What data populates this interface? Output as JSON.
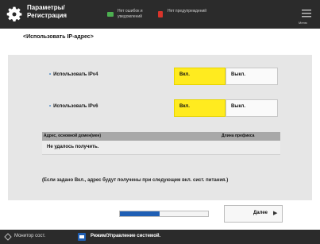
{
  "header": {
    "title_line1": "Параметры/",
    "title_line2": "Регистрация",
    "status_items": [
      {
        "icon": "toner-ok-icon",
        "text": "Нет ошибок и уведомлений"
      },
      {
        "icon": "warning-icon",
        "text": "Нет предупреждений"
      }
    ],
    "menu_label": "Меню",
    "colors": {
      "bar": "#2b2b2b"
    }
  },
  "breadcrumb": "<Использовать IP-адрес>",
  "settings": {
    "ipv4": {
      "label": "Использовать IPv4",
      "on_label": "Вкл.",
      "off_label": "Выкл.",
      "selected": "on"
    },
    "ipv6": {
      "label": "Использовать IPv6",
      "on_label": "Вкл.",
      "off_label": "Выкл.",
      "selected": "on"
    }
  },
  "table": {
    "headers": [
      "Адрес, основной домен(мен)",
      "Длина префикса"
    ],
    "rows": [
      [
        "Не удалось получить.",
        ""
      ]
    ]
  },
  "note": "(Если задано Вкл., адрес будут получены при следующем вкл. сист. питания.)",
  "footer": {
    "progress_fraction": 0.45,
    "next_label": "Далее",
    "next_arrow": "▶"
  },
  "bottom": {
    "monitor_label": "Монитор сост.",
    "system_label": "Режим/Управление системой.",
    "accent": "#1f5fb4",
    "selected_color": "#ffeb1f"
  }
}
